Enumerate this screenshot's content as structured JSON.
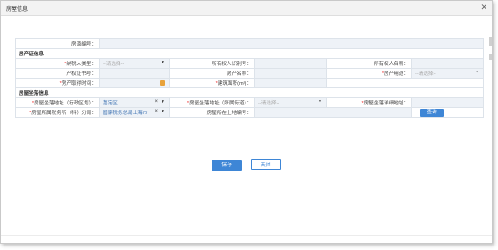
{
  "dialog": {
    "title": "房屋信息",
    "close_icon": "close-icon"
  },
  "fields": {
    "house_no": "房源编号：",
    "section_cert": "房产证信息",
    "taxpayer_type": "纳税人类型：",
    "taxpayer_type_placeholder": "--请选择--",
    "owner_id": "所有权人识别号：",
    "owner_name": "所有权人名称：",
    "cert_no": "产权证书号：",
    "property_name": "房产名称：",
    "property_use": "房产用途：",
    "property_use_placeholder": "--请选择--",
    "acquire_time": "房产取得时间：",
    "building_area": "建筑面积(m²)：",
    "section_location": "房屋坐落信息",
    "addr_district": "房屋坐落地址（行政区划）：",
    "addr_district_value": "嘉定区",
    "addr_street": "房屋坐落地址（所属街道）：",
    "addr_street_placeholder": "--请选择--",
    "addr_detail": "房屋坐落详细地址：",
    "tax_office": "房屋所属税务所（科）分局：",
    "tax_office_value": "国家税务总局上海市",
    "land_no": "房屋所在土地编号：",
    "query_button": "查询"
  },
  "buttons": {
    "save": "保存",
    "close": "关闭"
  }
}
